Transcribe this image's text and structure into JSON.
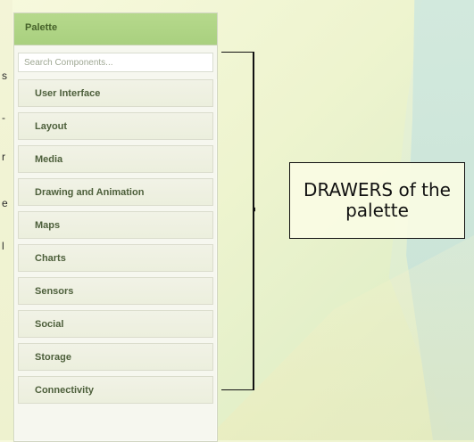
{
  "palette": {
    "title": "Palette",
    "search_placeholder": "Search Components...",
    "drawers": [
      "User Interface",
      "Layout",
      "Media",
      "Drawing and Animation",
      "Maps",
      "Charts",
      "Sensors",
      "Social",
      "Storage",
      "Connectivity"
    ]
  },
  "callout": {
    "text": "DRAWERS of the palette"
  },
  "left_strip": {
    "chars": [
      "s",
      "-",
      "r",
      "e",
      "l"
    ]
  }
}
